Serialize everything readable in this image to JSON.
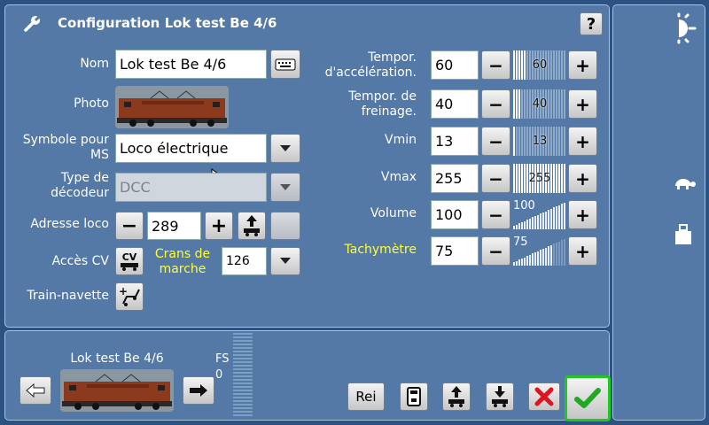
{
  "header": {
    "title": "Configuration Lok test Be 4/6",
    "help_label": "?"
  },
  "left": {
    "nom_label": "Nom",
    "nom_value": "Lok test Be 4/6",
    "photo_label": "Photo",
    "symbole_label_1": "Symbole pour",
    "symbole_label_2": "MS",
    "symbole_value": "Loco électrique",
    "decodeur_label_1": "Type de",
    "decodeur_label_2": "décodeur",
    "decodeur_value": "DCC",
    "adresse_label": "Adresse loco",
    "adresse_value": "289",
    "acces_cv_label": "Accès CV",
    "cv_button_label": "CV",
    "crans_label_1": "Crans de",
    "crans_label_2": "marche",
    "crans_value": "126",
    "train_navette_label": "Train-navette"
  },
  "right": {
    "rows": [
      {
        "label1": "Tempor.",
        "label2": "d'accélération.",
        "value": "60",
        "slider": "60",
        "kind": "slider",
        "level": 0.235
      },
      {
        "label1": "Tempor. de",
        "label2": "freinage.",
        "value": "40",
        "slider": "40",
        "kind": "slider",
        "level": 0.157
      },
      {
        "label1": "",
        "label2": "Vmin",
        "value": "13",
        "slider": "13",
        "kind": "slider",
        "level": 0.051
      },
      {
        "label1": "",
        "label2": "Vmax",
        "value": "255",
        "slider": "255",
        "kind": "slider",
        "level": 1.0
      },
      {
        "label1": "",
        "label2": "Volume",
        "value": "100",
        "slider": "100",
        "kind": "ramp",
        "level": 1.0
      },
      {
        "label1": "",
        "label2": "Tachymètre",
        "value": "75",
        "slider": "75",
        "kind": "ramp",
        "level": 0.75
      }
    ],
    "minus": "−",
    "plus": "+"
  },
  "bottom": {
    "loco_name": "Lok test Be 4/6",
    "fs_label": "FS",
    "fs_value": "0",
    "rei_label": "Rei"
  },
  "colors": {
    "accent_yellow": "#ffff30",
    "confirm_green": "#22c822",
    "cancel_red": "#e0141e"
  }
}
